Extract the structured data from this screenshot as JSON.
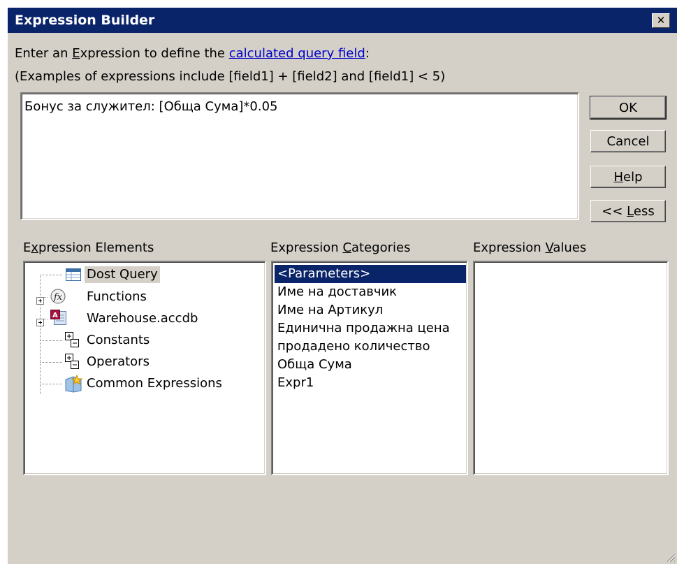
{
  "window": {
    "title": "Expression Builder",
    "close_glyph": "✕"
  },
  "instructions": {
    "line1_prefix": "Enter an ",
    "line1_access": "E",
    "line1_mid": "xpression to define the ",
    "line1_link": "calculated query field",
    "line1_suffix": ":",
    "line2": "(Examples of expressions include [field1] + [field2] and [field1] < 5)"
  },
  "expression": {
    "value": "Бонус за служител: [Обща Сума]*0.05"
  },
  "buttons": {
    "ok": "OK",
    "cancel": "Cancel",
    "help_access": "H",
    "help_rest": "elp",
    "less_prefix": "<< ",
    "less_access": "L",
    "less_rest": "ess"
  },
  "panes": {
    "elements_label_pre": "E",
    "elements_label_access": "x",
    "elements_label_post": "pression Elements",
    "categories_label_pre": "Expression ",
    "categories_label_access": "C",
    "categories_label_post": "ategories",
    "values_label_pre": "Expression ",
    "values_label_access": "V",
    "values_label_post": "alues"
  },
  "elements_tree": [
    {
      "label": "Dost Query",
      "icon": "query-icon",
      "expandable": false,
      "selected": true
    },
    {
      "label": "Functions",
      "icon": "function-icon",
      "expandable": true,
      "selected": false
    },
    {
      "label": "Warehouse.accdb",
      "icon": "database-icon",
      "expandable": true,
      "selected": false
    },
    {
      "label": "Constants",
      "icon": "constants-icon",
      "expandable": false,
      "selected": false
    },
    {
      "label": "Operators",
      "icon": "operators-icon",
      "expandable": false,
      "selected": false
    },
    {
      "label": "Common Expressions",
      "icon": "common-expressions-icon",
      "expandable": false,
      "selected": false
    }
  ],
  "categories": [
    {
      "label": "<Parameters>",
      "selected": true
    },
    {
      "label": "Име на доставчик",
      "selected": false
    },
    {
      "label": "Име на Артикул",
      "selected": false
    },
    {
      "label": "Единична продажна цена",
      "selected": false
    },
    {
      "label": "продадено количество",
      "selected": false
    },
    {
      "label": "Обща Сума",
      "selected": false
    },
    {
      "label": "Expr1",
      "selected": false
    }
  ],
  "values": [],
  "colors": {
    "titlebar": "#0a246a",
    "face": "#d4d0c8",
    "selection": "#0a246a",
    "link": "#0000cc"
  }
}
